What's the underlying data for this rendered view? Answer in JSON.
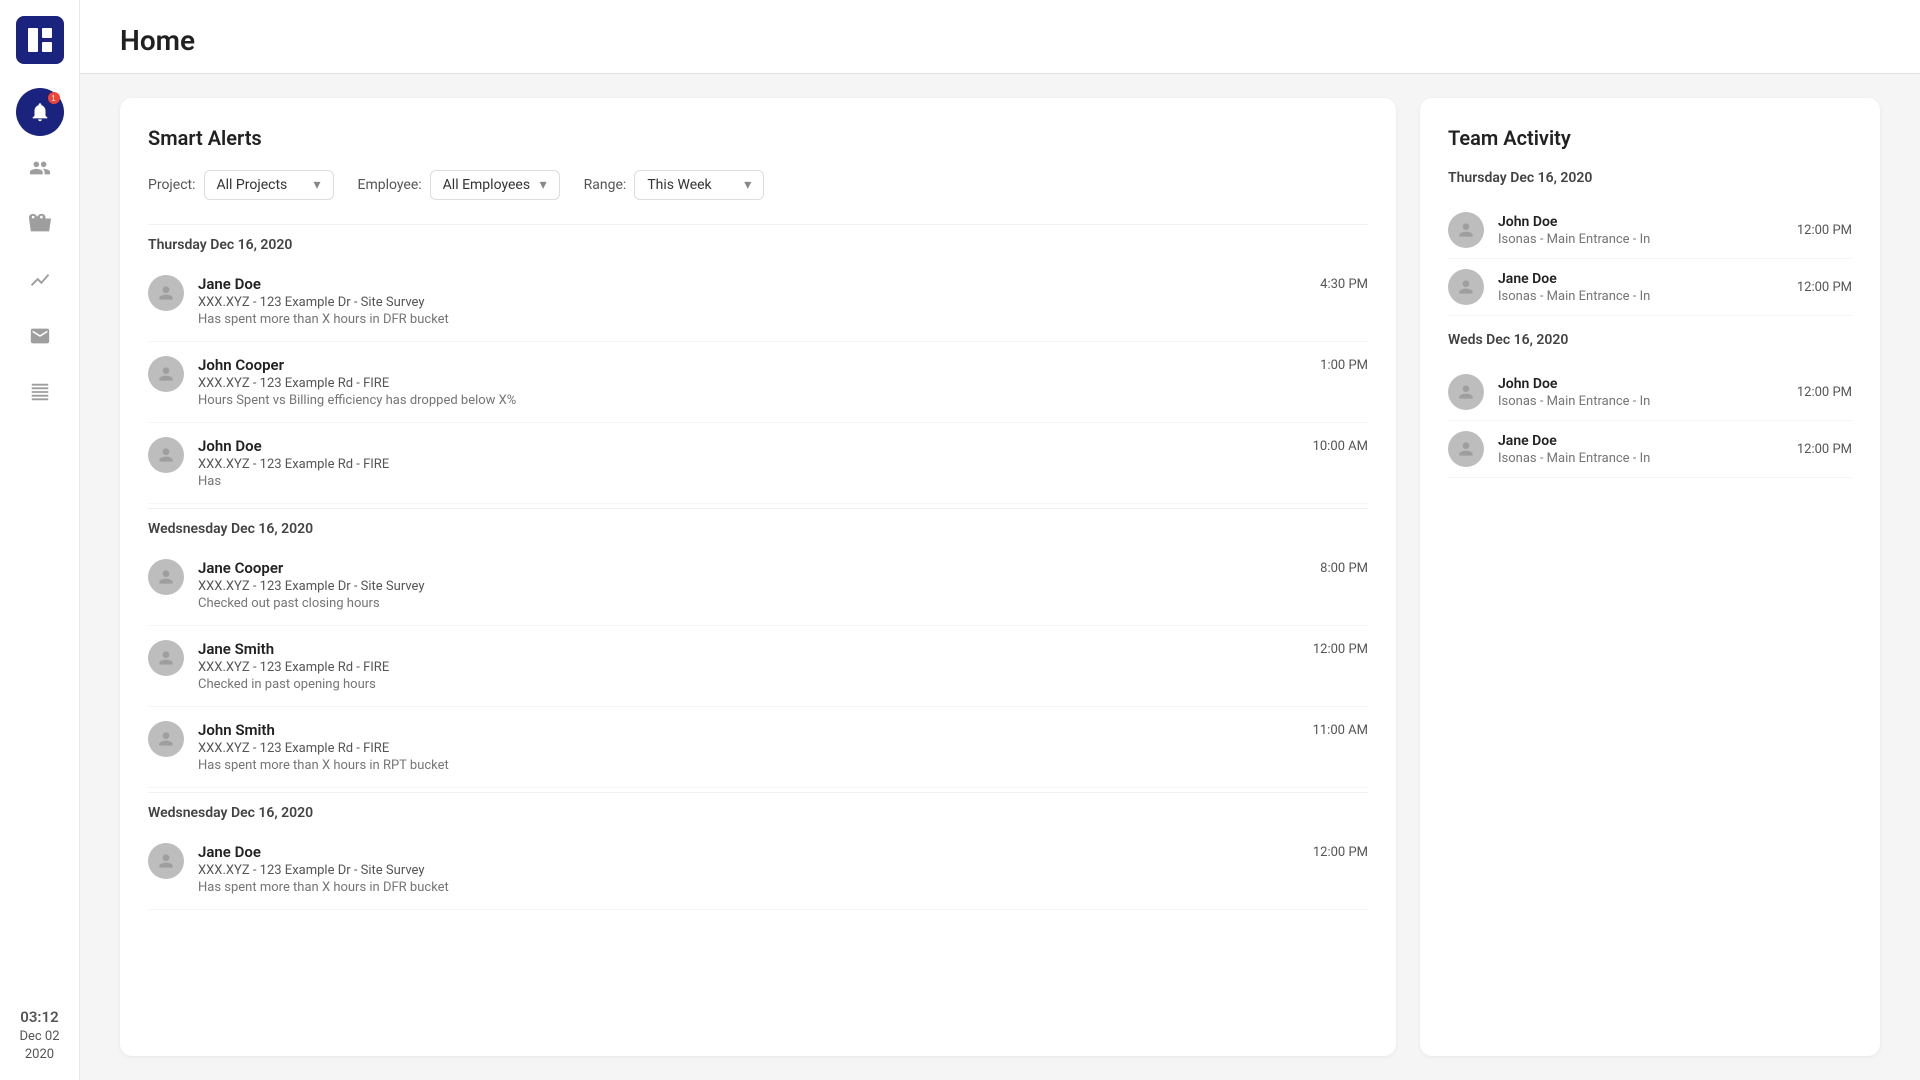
{
  "app": {
    "logo_alt": "App Logo",
    "time": "03:12",
    "date": "Dec 02",
    "year": "2020"
  },
  "header": {
    "title": "Home"
  },
  "sidebar": {
    "icons": [
      {
        "name": "bell-icon",
        "label": "Notifications",
        "active": true,
        "badge": "1"
      },
      {
        "name": "people-icon",
        "label": "Team",
        "active": false
      },
      {
        "name": "briefcase-icon",
        "label": "Projects",
        "active": false
      },
      {
        "name": "chart-icon",
        "label": "Reports",
        "active": false
      },
      {
        "name": "email-icon",
        "label": "Messages",
        "active": false
      },
      {
        "name": "table-icon",
        "label": "Data",
        "active": false
      }
    ]
  },
  "smart_alerts": {
    "title": "Smart Alerts",
    "filters": {
      "project_label": "Project:",
      "project_value": "All Projects",
      "employee_label": "Employee:",
      "employee_value": "All Employees",
      "range_label": "Range:",
      "range_value": "This Week"
    },
    "sections": [
      {
        "date": "Thursday Dec 16, 2020",
        "alerts": [
          {
            "name": "Jane Doe",
            "project": "XXX.XYZ - 123 Example Dr - Site Survey",
            "description": "Has spent more than X hours in DFR bucket",
            "time": "4:30 PM"
          },
          {
            "name": "John Cooper",
            "project": "XXX.XYZ - 123 Example Rd - FIRE",
            "description": "Hours Spent vs Billing efficiency has dropped below X%",
            "time": "1:00 PM"
          },
          {
            "name": "John Doe",
            "project": "XXX.XYZ - 123 Example Rd - FIRE",
            "description": "Has",
            "time": "10:00 AM"
          }
        ]
      },
      {
        "date": "Wedsnesday Dec 16, 2020",
        "alerts": [
          {
            "name": "Jane Cooper",
            "project": "XXX.XYZ - 123 Example Dr - Site Survey",
            "description": "Checked out past closing hours",
            "time": "8:00 PM"
          },
          {
            "name": "Jane Smith",
            "project": "XXX.XYZ - 123 Example Rd - FIRE",
            "description": "Checked in past opening hours",
            "time": "12:00 PM"
          },
          {
            "name": "John Smith",
            "project": "XXX.XYZ - 123 Example Rd - FIRE",
            "description": "Has spent more than X hours in RPT bucket",
            "time": "11:00 AM"
          }
        ]
      },
      {
        "date": "Wedsnesday Dec 16, 2020",
        "alerts": [
          {
            "name": "Jane Doe",
            "project": "XXX.XYZ - 123 Example Dr - Site Survey",
            "description": "Has spent more than X hours in DFR bucket",
            "time": "12:00 PM"
          }
        ]
      }
    ]
  },
  "team_activity": {
    "title": "Team Activity",
    "sections": [
      {
        "date": "Thursday Dec 16, 2020",
        "items": [
          {
            "name": "John Doe",
            "detail": "Isonas - Main Entrance - In",
            "time": "12:00 PM"
          },
          {
            "name": "Jane Doe",
            "detail": "Isonas - Main Entrance - In",
            "time": "12:00 PM"
          }
        ]
      },
      {
        "date": "Weds Dec 16, 2020",
        "items": [
          {
            "name": "John Doe",
            "detail": "Isonas - Main Entrance - In",
            "time": "12:00 PM"
          },
          {
            "name": "Jane Doe",
            "detail": "Isonas - Main Entrance - In",
            "time": "12:00 PM"
          }
        ]
      }
    ]
  }
}
